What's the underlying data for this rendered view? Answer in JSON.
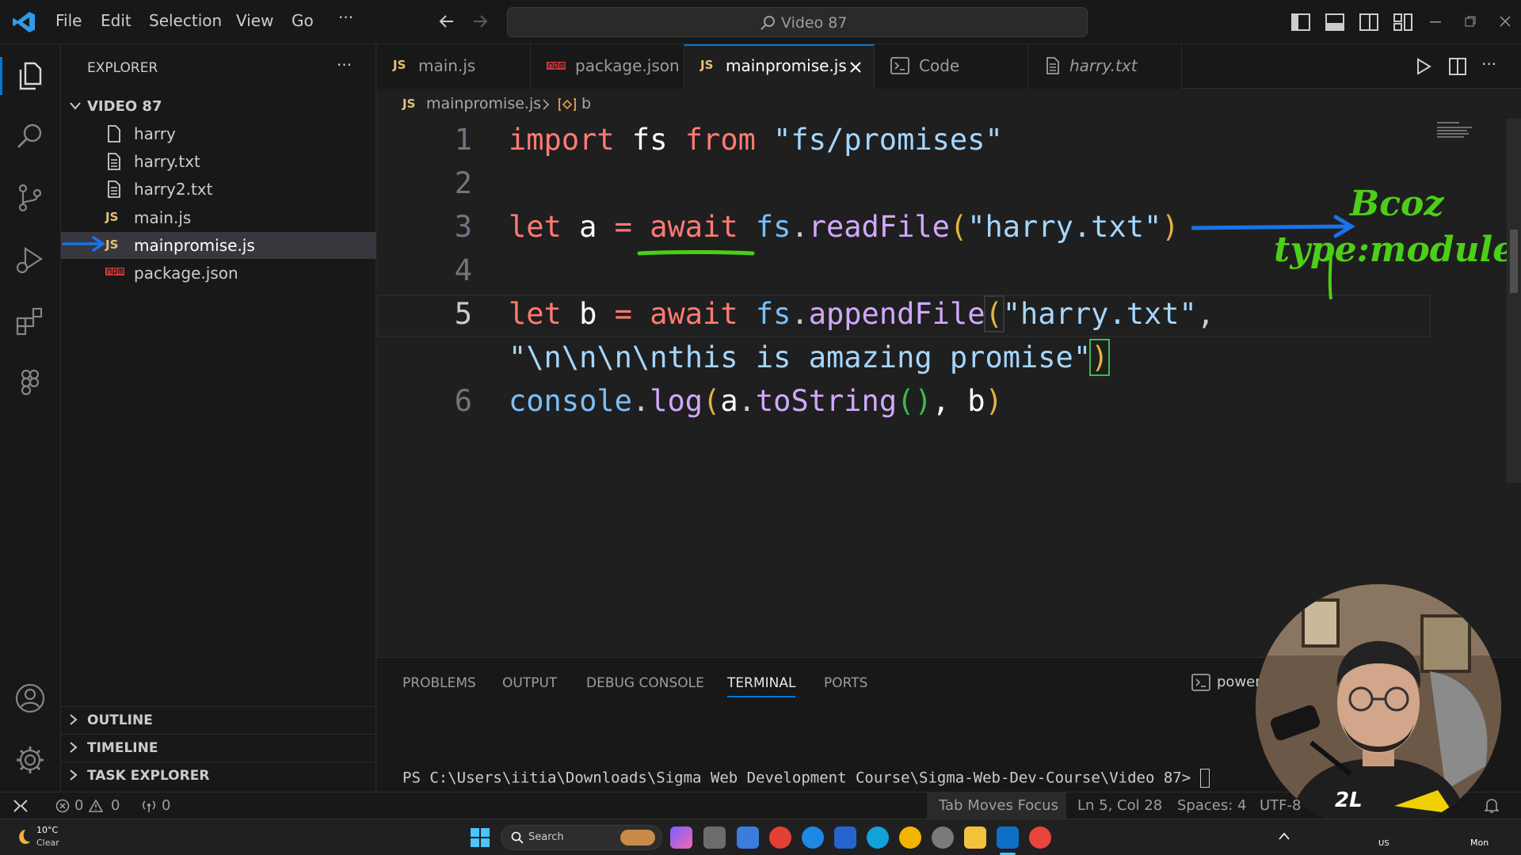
{
  "titlebar": {
    "menu": [
      "File",
      "Edit",
      "Selection",
      "View",
      "Go",
      "···"
    ],
    "search_text": "Video 87"
  },
  "explorer": {
    "header": "EXPLORER",
    "more": "···",
    "folder": "VIDEO 87",
    "files": [
      {
        "name": "harry",
        "icon": "file-icon"
      },
      {
        "name": "harry.txt",
        "icon": "text-file-icon"
      },
      {
        "name": "harry2.txt",
        "icon": "text-file-icon"
      },
      {
        "name": "main.js",
        "icon": "js-file-icon"
      },
      {
        "name": "mainpromise.js",
        "icon": "js-file-icon"
      },
      {
        "name": "package.json",
        "icon": "npm-icon"
      }
    ],
    "sections": [
      "OUTLINE",
      "TIMELINE",
      "TASK EXPLORER"
    ]
  },
  "tabs": [
    {
      "label": "main.js",
      "icon_text": "JS"
    },
    {
      "label": "package.json",
      "icon_text": "npm"
    },
    {
      "label": "mainpromise.js",
      "icon_text": "JS"
    },
    {
      "label": "Code",
      "icon_text": ""
    },
    {
      "label": "harry.txt",
      "icon_text": ""
    }
  ],
  "breadcrumb": {
    "file_icon": "JS",
    "file": "mainpromise.js",
    "symbol": "b"
  },
  "editor": {
    "line_numbers": [
      "1",
      "2",
      "3",
      "4",
      "5",
      "6"
    ],
    "line1": {
      "kw1": "import",
      "id": " fs ",
      "kw2": "from",
      "str": " \"fs/promises\""
    },
    "line3": {
      "kw1": "let",
      "id": " a ",
      "op": "=",
      "kw2": "await",
      "obj": "fs",
      "dot": ".",
      "fn": "readFile",
      "p1": "(",
      "str": "\"harry.txt\"",
      "p2": ")"
    },
    "line5": {
      "kw1": "let",
      "id": " b ",
      "op": "=",
      "kw2": "await",
      "obj": "fs",
      "dot": ".",
      "fn": "appendFile",
      "p1": "(",
      "str": "\"harry.txt\"",
      "comma": ","
    },
    "line5b": {
      "str": "\"\\n\\n\\n\\nthis is amazing promise\"",
      "p2": ")"
    },
    "line6": {
      "obj": "console",
      "dot": ".",
      "fn": "log",
      "p1": "(",
      "a": "a",
      "dot2": ".",
      "fn2": "toString",
      "pp": "()",
      "rest": ", b",
      "p2": ")"
    }
  },
  "annotation": {
    "line1": "Bcoz",
    "line2": "type:module"
  },
  "panel": {
    "tabs": [
      "PROBLEMS",
      "OUTPUT",
      "DEBUG CONSOLE",
      "TERMINAL",
      "PORTS"
    ],
    "terminal_label": "powers",
    "prompt": "PS C:\\Users\\iitia\\Downloads\\Sigma Web Development Course\\Sigma-Web-Dev-Course\\Video 87> "
  },
  "statusbar": {
    "errors": "0",
    "warnings": "0",
    "ports": "0",
    "tab_focus": "Tab Moves Focus",
    "position": "Ln 5, Col 28",
    "spaces": "Spaces: 4",
    "encoding": "UTF-8"
  },
  "taskbar": {
    "temp": "10°C",
    "weather": "Clear",
    "search": "Search",
    "lang": "US",
    "day": "Mon"
  },
  "webcam": {
    "badge": "2L"
  }
}
